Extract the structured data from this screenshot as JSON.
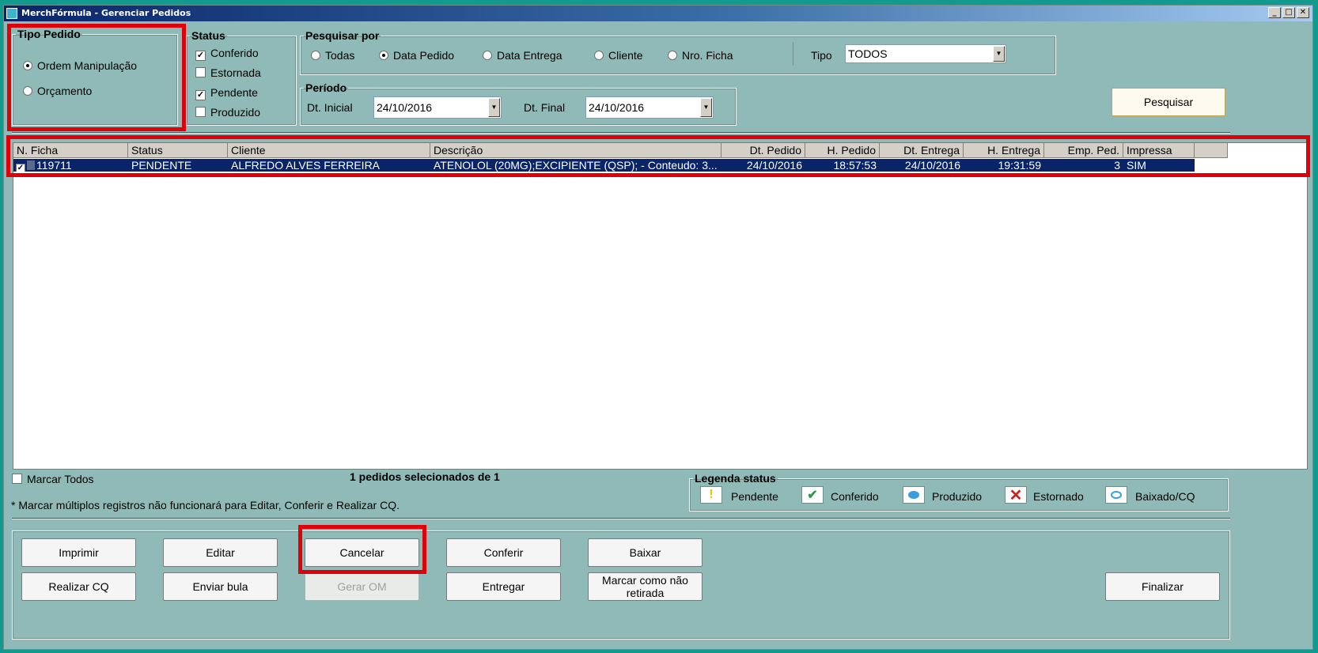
{
  "window": {
    "title": "MerchFórmula - Gerenciar Pedidos",
    "buttons": [
      "_",
      "□",
      "✕"
    ]
  },
  "tipo_pedido": {
    "legend": "Tipo Pedido",
    "options": [
      {
        "label": "Ordem Manipulação",
        "selected": true
      },
      {
        "label": "Orçamento",
        "selected": false
      }
    ]
  },
  "status": {
    "legend": "Status",
    "options": [
      {
        "label": "Conferido",
        "checked": true
      },
      {
        "label": "Estornada",
        "checked": false
      },
      {
        "label": "Pendente",
        "checked": true
      },
      {
        "label": "Produzido",
        "checked": false
      }
    ]
  },
  "pesquisar_por": {
    "legend": "Pesquisar por",
    "options": [
      {
        "label": "Todas",
        "selected": false
      },
      {
        "label": "Data Pedido",
        "selected": true
      },
      {
        "label": "Data Entrega",
        "selected": false
      },
      {
        "label": "Cliente",
        "selected": false
      },
      {
        "label": "Nro. Ficha",
        "selected": false
      }
    ],
    "tipo_label": "Tipo",
    "tipo_value": "TODOS"
  },
  "periodo": {
    "legend": "Período",
    "dt_inicial_label": "Dt. Inicial",
    "dt_inicial_value": "24/10/2016",
    "dt_final_label": "Dt. Final",
    "dt_final_value": "24/10/2016"
  },
  "pesquisar_button": "Pesquisar",
  "grid": {
    "columns": [
      "N. Ficha",
      "Status",
      "Cliente",
      "Descrição",
      "Dt. Pedido",
      "H. Pedido",
      "Dt. Entrega",
      "H. Entrega",
      "Emp. Ped.",
      "Impressa"
    ],
    "rows": [
      {
        "ficha": "119711",
        "status": "PENDENTE",
        "cliente": "ALFREDO ALVES FERREIRA",
        "descricao": "ATENOLOL (20MG);EXCIPIENTE (QSP); -  Conteudo: 3...",
        "dt_pedido": "24/10/2016",
        "h_pedido": "18:57:53",
        "dt_entrega": "24/10/2016",
        "h_entrega": "19:31:59",
        "emp_ped": "3",
        "impressa": "SIM",
        "checked": true
      }
    ]
  },
  "marcar_todos": "Marcar Todos",
  "selection_info": "1 pedidos selecionados de 1",
  "note": "* Marcar múltiplos registros não funcionará para Editar, Conferir e Realizar CQ.",
  "legenda": {
    "legend": "Legenda status",
    "items": [
      {
        "label": "Pendente",
        "icon": "exclamation-icon",
        "color": "#f0c000"
      },
      {
        "label": "Conferido",
        "icon": "checkmark-icon",
        "color": "#2a9d4a"
      },
      {
        "label": "Produzido",
        "icon": "blue-dot-icon",
        "color": "#3b9de0"
      },
      {
        "label": "Estornado",
        "icon": "red-x-icon",
        "color": "#d02020"
      },
      {
        "label": "Baixado/CQ",
        "icon": "blue-ring-icon",
        "color": "#3b9de0"
      }
    ]
  },
  "buttons": {
    "imprimir": "Imprimir",
    "editar": "Editar",
    "cancelar": "Cancelar",
    "conferir": "Conferir",
    "baixar": "Baixar",
    "realizar_cq": "Realizar CQ",
    "enviar_bula": "Enviar bula",
    "gerar_om": "Gerar OM",
    "entregar": "Entregar",
    "marcar_nao_retirada": "Marcar como não retirada",
    "finalizar": "Finalizar"
  }
}
